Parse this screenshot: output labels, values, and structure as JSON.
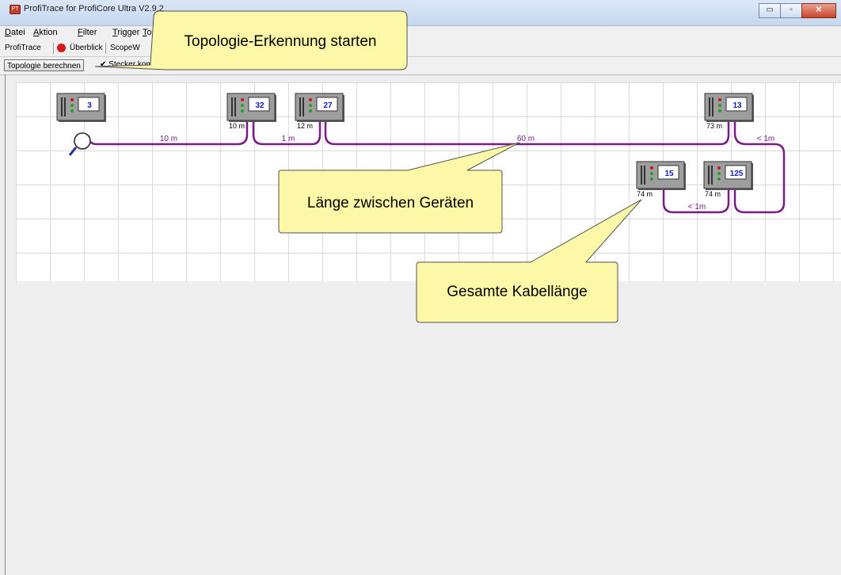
{
  "window": {
    "title": "ProfiTrace for ProfiCore Ultra V2.9.2",
    "controls": {
      "minimize": "▭",
      "maximize": "▫",
      "close": "✕"
    }
  },
  "menu": [
    "Datei",
    "Aktion",
    "Filter",
    "Trigger",
    "To"
  ],
  "tabs": [
    "ProfiTrace",
    "Überblick",
    "ScopeW"
  ],
  "toolbar": {
    "compute_label": "Topologie berechnen",
    "connector_label": "Stecker kom"
  },
  "topology": {
    "devices": [
      {
        "address": "3",
        "distance": ""
      },
      {
        "address": "32",
        "distance": "10 m"
      },
      {
        "address": "27",
        "distance": "12 m"
      },
      {
        "address": "13",
        "distance": "73 m"
      },
      {
        "address": "15",
        "distance": "74 m"
      },
      {
        "address": "125",
        "distance": "74 m"
      }
    ],
    "segments": [
      {
        "length": "10 m"
      },
      {
        "length": "1 m"
      },
      {
        "length": "60 m"
      },
      {
        "length": "< 1m"
      },
      {
        "length": "< 1m"
      }
    ]
  },
  "callouts": {
    "start": "Topologie-Erkennung starten",
    "length_between": "Länge zwischen Geräten",
    "total_length": "Gesamte Kabellänge"
  },
  "colors": {
    "cable": "#7a1a8a",
    "callout_fill": "#fdf8a8",
    "callout_border": "#505050",
    "device_body": "#9e9e9e",
    "address_text": "#1020c0"
  }
}
